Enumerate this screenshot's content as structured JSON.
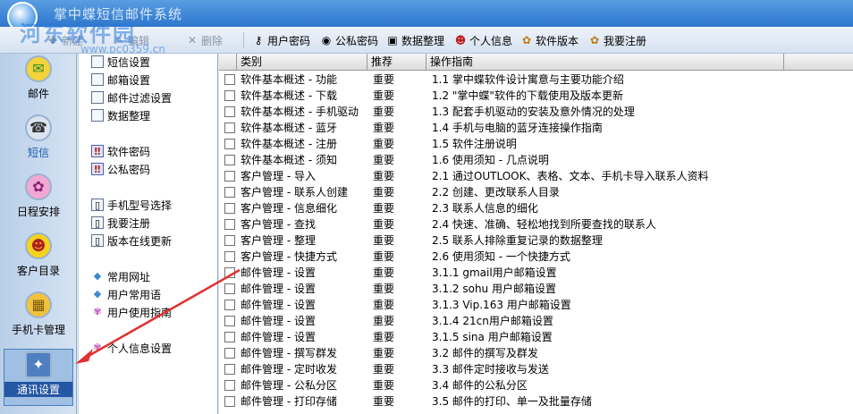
{
  "window": {
    "title": "掌中蝶短信邮件系统",
    "watermark": "河东软件园",
    "watermark_url": "www.pc0359.cn"
  },
  "toolbar": {
    "new_label": "新建",
    "edit_label": "编辑",
    "delete_label": "删除",
    "user_password_label": "用户密码",
    "private_password_label": "公私密码",
    "data_cleanup_label": "数据整理",
    "personal_info_label": "个人信息",
    "software_version_label": "软件版本",
    "register_label": "我要注册"
  },
  "sidebar": {
    "items": [
      {
        "label": "邮件",
        "icon": "mail-icon"
      },
      {
        "label": "短信",
        "icon": "phone-icon"
      },
      {
        "label": "日程安排",
        "icon": "calendar-icon"
      },
      {
        "label": "客户目录",
        "icon": "smiley-icon"
      },
      {
        "label": "手机卡管理",
        "icon": "simcard-icon"
      },
      {
        "label": "通讯设置",
        "icon": "settings-icon"
      }
    ],
    "selected": "通讯设置"
  },
  "tree": {
    "items": [
      {
        "label": "短信设置",
        "icon": "doc-icon"
      },
      {
        "label": "邮箱设置",
        "icon": "doc-icon"
      },
      {
        "label": "邮件过滤设置",
        "icon": "doc-icon"
      },
      {
        "label": "数据整理",
        "icon": "doc-icon"
      },
      {
        "label": "软件密码",
        "icon": "shield-icon"
      },
      {
        "label": "公私密码",
        "icon": "shield-icon"
      },
      {
        "label": "手机型号选择",
        "icon": "phone-doc-icon"
      },
      {
        "label": "我要注册",
        "icon": "phone-doc-icon"
      },
      {
        "label": "版本在线更新",
        "icon": "phone-doc-icon"
      },
      {
        "label": "常用网址",
        "icon": "gem-icon"
      },
      {
        "label": "用户常用语",
        "icon": "gem-icon"
      },
      {
        "label": "用户使用指南",
        "icon": "flower-icon"
      },
      {
        "label": "个人信息设置",
        "icon": "flower-icon"
      }
    ]
  },
  "grid": {
    "columns": [
      "类别",
      "推荐",
      "操作指南"
    ],
    "rows": [
      {
        "category": "软件基本概述 - 功能",
        "priority": "重要",
        "guide": "1.1 掌中蝶软件设计寓意与主要功能介绍"
      },
      {
        "category": "软件基本概述 - 下载",
        "priority": "重要",
        "guide": "1.2 \"掌中蝶\"软件的下载使用及版本更新"
      },
      {
        "category": "软件基本概述 - 手机驱动",
        "priority": "重要",
        "guide": "1.3 配套手机驱动的安装及意外情况的处理"
      },
      {
        "category": "软件基本概述 - 蓝牙",
        "priority": "重要",
        "guide": "1.4 手机与电脑的蓝牙连接操作指南"
      },
      {
        "category": "软件基本概述 - 注册",
        "priority": "重要",
        "guide": "1.5 软件注册说明"
      },
      {
        "category": "软件基本概述 - 须知",
        "priority": "重要",
        "guide": "1.6 使用须知 - 几点说明"
      },
      {
        "category": "客户管理 - 导入",
        "priority": "重要",
        "guide": "2.1 通过OUTLOOK、表格、文本、手机卡导入联系人资料"
      },
      {
        "category": "客户管理 - 联系人创建",
        "priority": "重要",
        "guide": "2.2 创建、更改联系人目录"
      },
      {
        "category": "客户管理 - 信息细化",
        "priority": "重要",
        "guide": "2.3 联系人信息的细化"
      },
      {
        "category": "客户管理 - 查找",
        "priority": "重要",
        "guide": "2.4 快速、准确、轻松地找到所要查找的联系人"
      },
      {
        "category": "客户管理 - 整理",
        "priority": "重要",
        "guide": "2.5 联系人排除重复记录的数据整理"
      },
      {
        "category": "客户管理 - 快捷方式",
        "priority": "重要",
        "guide": "2.6 使用须知 - 一个快捷方式"
      },
      {
        "category": "邮件管理 - 设置",
        "priority": "重要",
        "guide": "3.1.1 gmail用户邮箱设置"
      },
      {
        "category": "邮件管理 - 设置",
        "priority": "重要",
        "guide": "3.1.2 sohu 用户邮箱设置"
      },
      {
        "category": "邮件管理 - 设置",
        "priority": "重要",
        "guide": "3.1.3 Vip.163 用户邮箱设置"
      },
      {
        "category": "邮件管理 - 设置",
        "priority": "重要",
        "guide": "3.1.4 21cn用户邮箱设置"
      },
      {
        "category": "邮件管理 - 设置",
        "priority": "重要",
        "guide": "3.1.5 sina 用户邮箱设置"
      },
      {
        "category": "邮件管理 - 撰写群发",
        "priority": "重要",
        "guide": "3.2 邮件的撰写及群发"
      },
      {
        "category": "邮件管理 - 定时收发",
        "priority": "重要",
        "guide": "3.3 邮件定时接收与发送"
      },
      {
        "category": "邮件管理 - 公私分区",
        "priority": "重要",
        "guide": "3.4 邮件的公私分区"
      },
      {
        "category": "邮件管理 - 打印存储",
        "priority": "重要",
        "guide": "3.5 邮件的打印、单一及批量存储"
      }
    ]
  },
  "colors": {
    "accent": "#2457a4",
    "annotation_arrow": "#e03030"
  }
}
